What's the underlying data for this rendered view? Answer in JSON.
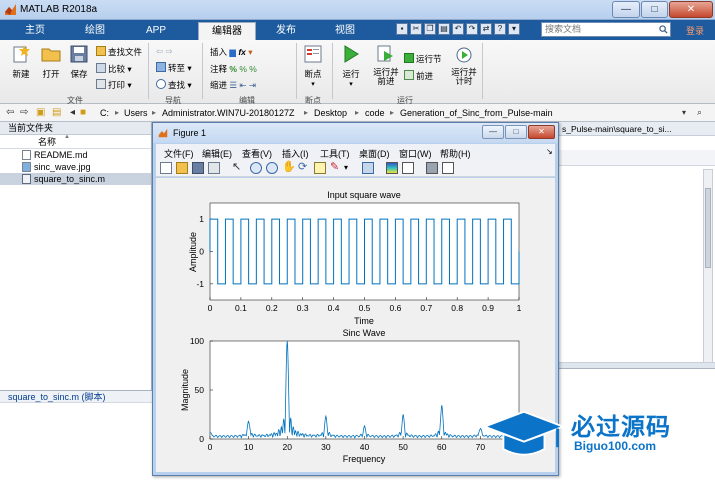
{
  "window": {
    "title": "MATLAB R2018a",
    "min": "—",
    "max": "□",
    "close": "✕"
  },
  "tabs": [
    "主页",
    "绘图",
    "APP",
    "编辑器",
    "发布",
    "视图"
  ],
  "active_tab_index": 3,
  "search": {
    "placeholder": "搜索文档"
  },
  "signin": "登录",
  "ribbon": {
    "new": "新建",
    "open": "打开",
    "save": "保存",
    "find_files": "查找文件",
    "compare": "比较",
    "print": "打印",
    "goto": "转至",
    "find": "查找",
    "insert": "插入",
    "comment": "注释",
    "indent": "缩进",
    "fx": "fx",
    "breakpoints": "断点",
    "run": "运行",
    "run_advance": "运行并\n前进",
    "run_section": "运行节",
    "advance": "前进",
    "run_time": "运行并\n计时",
    "groups": {
      "file": "文件",
      "navigate": "导航",
      "edit": "编辑",
      "breakpoints": "断点",
      "run": "运行"
    }
  },
  "address": {
    "crumbs": [
      "C:",
      "Users",
      "Administrator.WIN7U-20180127Z",
      "Desktop",
      "code",
      "Generation_of_Sinc_from_Pulse-main"
    ]
  },
  "current_folder": {
    "title": "当前文件夹",
    "column": "名称",
    "sort_arrow": "▲",
    "files": [
      {
        "name": "README.md",
        "type": "md"
      },
      {
        "name": "sinc_wave.jpg",
        "type": "jpg"
      },
      {
        "name": "square_to_sinc.m",
        "type": "m",
        "selected": true
      }
    ],
    "details": "square_to_sinc.m  (脚本)"
  },
  "editor": {
    "tab": "s_Pulse-main\\square_to_si..."
  },
  "figure": {
    "title": "Figure 1",
    "menu": [
      "文件(F)",
      "编辑(E)",
      "查看(V)",
      "插入(I)",
      "工具(T)",
      "桌面(D)",
      "窗口(W)",
      "帮助(H)"
    ]
  },
  "chart_data": [
    {
      "type": "line",
      "title": "Input square wave",
      "xlabel": "Time",
      "ylabel": "Amplitude",
      "xlim": [
        0,
        1
      ],
      "ylim": [
        -1.5,
        1.5
      ],
      "xticks": [
        "0",
        "0.1",
        "0.2",
        "0.3",
        "0.4",
        "0.5",
        "0.6",
        "0.7",
        "0.8",
        "0.9",
        "1"
      ],
      "yticks": [
        "-1",
        "0",
        "1"
      ],
      "series": [
        {
          "description": "square wave, amplitude ±1",
          "frequency_hz": 20,
          "amplitude": 1
        }
      ],
      "color": "#0072bd"
    },
    {
      "type": "line",
      "title": "Sinc Wave",
      "xlabel": "Frequency",
      "ylabel": "Magnitude",
      "xlim": [
        0,
        80
      ],
      "ylim": [
        0,
        100
      ],
      "xticks": [
        "0",
        "10",
        "20",
        "30",
        "40",
        "50",
        "60",
        "70"
      ],
      "yticks": [
        "0",
        "50",
        "100"
      ],
      "peaks": [
        {
          "x": 0,
          "y": 5
        },
        {
          "x": 10,
          "y": 16
        },
        {
          "x": 20,
          "y": 98
        },
        {
          "x": 30,
          "y": 20
        },
        {
          "x": 40,
          "y": 10
        },
        {
          "x": 50,
          "y": 22
        },
        {
          "x": 60,
          "y": 32
        },
        {
          "x": 70,
          "y": 9
        }
      ],
      "color": "#0072bd"
    }
  ],
  "watermark": {
    "big": "必过源码",
    "small": "Biguo100.com"
  }
}
